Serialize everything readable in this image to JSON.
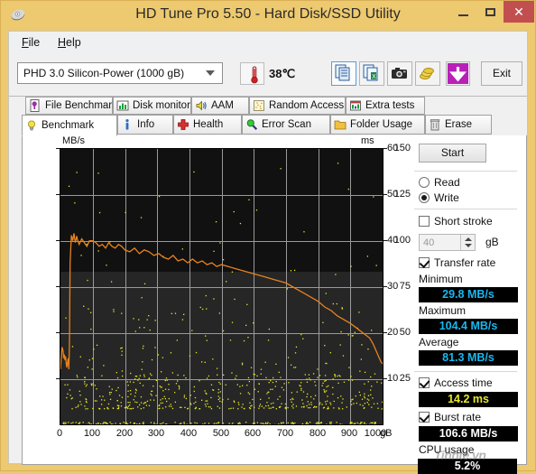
{
  "window": {
    "title": "HD Tune Pro 5.50 - Hard Disk/SSD Utility",
    "app_icon": "hard-disk-icon",
    "minimize": "–",
    "maximize": "□",
    "close": "✕"
  },
  "menu": {
    "items": [
      {
        "label": "File",
        "mnemonic": "F"
      },
      {
        "label": "Help",
        "mnemonic": "H"
      }
    ]
  },
  "toolbar": {
    "drive_selected": "PHD 3.0 Silicon-Power (1000 gB)",
    "temperature": "38℃",
    "thermometer_icon": "thermometer-icon",
    "buttons": [
      {
        "name": "copy-icon",
        "label": ""
      },
      {
        "name": "copy-excel-icon",
        "label": ""
      },
      {
        "name": "camera-icon",
        "label": ""
      },
      {
        "name": "coins-icon",
        "label": ""
      },
      {
        "name": "download-arrow-icon",
        "label": ""
      }
    ],
    "exit_label": "Exit"
  },
  "tabs": {
    "row1": [
      {
        "label": "File Benchmark",
        "icon": "file-benchmark-icon",
        "active": false
      },
      {
        "label": "Disk monitor",
        "icon": "disk-monitor-icon",
        "active": false
      },
      {
        "label": "AAM",
        "icon": "speaker-icon",
        "active": false
      },
      {
        "label": "Random Access",
        "icon": "random-access-icon",
        "active": false
      },
      {
        "label": "Extra tests",
        "icon": "extra-tests-icon",
        "active": false
      }
    ],
    "row2": [
      {
        "label": "Benchmark",
        "icon": "lightbulb-icon",
        "active": true
      },
      {
        "label": "Info",
        "icon": "info-icon",
        "active": false
      },
      {
        "label": "Health",
        "icon": "health-cross-icon",
        "active": false
      },
      {
        "label": "Error Scan",
        "icon": "magnifier-icon",
        "active": false
      },
      {
        "label": "Folder Usage",
        "icon": "folder-icon",
        "active": false
      },
      {
        "label": "Erase",
        "icon": "trash-icon",
        "active": false
      }
    ]
  },
  "panel": {
    "start_label": "Start",
    "mode_read": "Read",
    "mode_write": "Write",
    "mode_selected": "Write",
    "short_stroke_label": "Short stroke",
    "short_stroke_checked": false,
    "short_stroke_value": "40",
    "short_stroke_unit": "gB",
    "transfer_rate_label": "Transfer rate",
    "transfer_rate_checked": true,
    "minimum_label": "Minimum",
    "minimum_value": "29.8 MB/s",
    "maximum_label": "Maximum",
    "maximum_value": "104.4 MB/s",
    "average_label": "Average",
    "average_value": "81.3 MB/s",
    "access_time_label": "Access time",
    "access_time_checked": true,
    "access_time_value": "14.2 ms",
    "burst_rate_label": "Burst rate",
    "burst_rate_checked": true,
    "burst_rate_value": "106.6 MB/s",
    "cpu_usage_label": "CPU usage",
    "cpu_usage_value": "5.2%"
  },
  "watermark": "Tinhte.vn",
  "chart_data": {
    "type": "line",
    "title": "",
    "xlabel": "gB",
    "ylabel": "MB/s",
    "y2label": "ms",
    "xlim": [
      0,
      1000
    ],
    "ylim": [
      0,
      150
    ],
    "y2lim": [
      0,
      60
    ],
    "grid": true,
    "background": "#111111",
    "xticks": [
      0,
      100,
      200,
      300,
      400,
      500,
      600,
      700,
      800,
      900,
      1000
    ],
    "yticks": [
      25,
      50,
      75,
      100,
      125,
      150
    ],
    "y2ticks": [
      10,
      20,
      30,
      40,
      50,
      60
    ],
    "series": [
      {
        "name": "Transfer rate",
        "color": "#e8821e",
        "type": "line",
        "axis": "left",
        "x": [
          0,
          5,
          8,
          10,
          12,
          14,
          16,
          18,
          20,
          22,
          24,
          26,
          28,
          30,
          34,
          38,
          42,
          46,
          50,
          58,
          66,
          74,
          82,
          90,
          100,
          110,
          120,
          130,
          140,
          150,
          160,
          170,
          180,
          190,
          200,
          215,
          230,
          245,
          260,
          275,
          290,
          305,
          320,
          335,
          350,
          365,
          380,
          395,
          410,
          425,
          440,
          455,
          470,
          485,
          500,
          520,
          540,
          560,
          580,
          600,
          620,
          640,
          660,
          680,
          700,
          720,
          740,
          760,
          780,
          800,
          820,
          840,
          860,
          880,
          900,
          915,
          930,
          945,
          960,
          970,
          980,
          990,
          995,
          1000
        ],
        "y": [
          30,
          42,
          40,
          36,
          38,
          35,
          37,
          33,
          31,
          34,
          36,
          30,
          45,
          88,
          103,
          100,
          104,
          99,
          102,
          98,
          101,
          99,
          97,
          100,
          100,
          99,
          97,
          98,
          96,
          99,
          97,
          96,
          98,
          97,
          95,
          94,
          96,
          93,
          95,
          94,
          92,
          93,
          91,
          90,
          92,
          89,
          90,
          88,
          90,
          88,
          89,
          87,
          88,
          86,
          87,
          86,
          85,
          84,
          83,
          82,
          81,
          80,
          79,
          78,
          77,
          75,
          73,
          71,
          69,
          67,
          64,
          62,
          59,
          57,
          55,
          53,
          51,
          49,
          47,
          44,
          40,
          36,
          34,
          33
        ]
      },
      {
        "name": "Access time",
        "color": "#e8e82a",
        "type": "scatter",
        "axis": "right",
        "note": "Dense scatter of access-time samples, mostly 4-9 ms with outliers up to 58 ms across the full 0-1000 gB range, plus a dense band along the 0 ms baseline."
      }
    ]
  }
}
